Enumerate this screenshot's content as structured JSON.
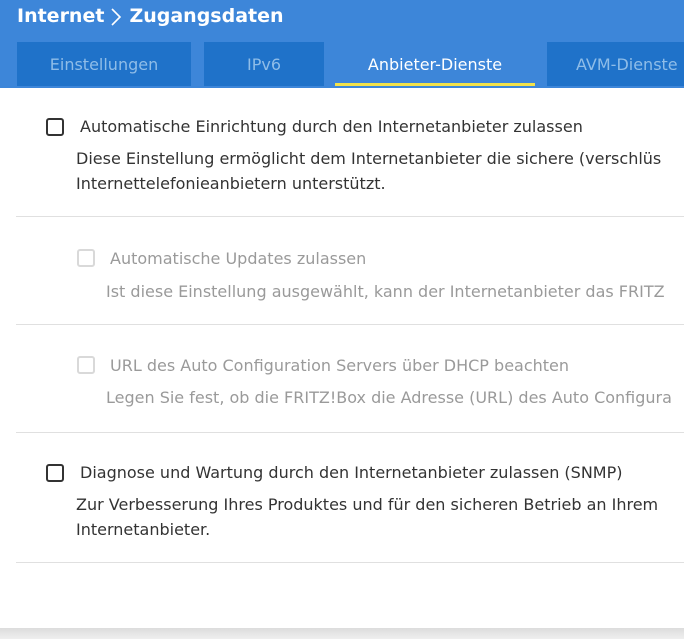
{
  "breadcrumb": {
    "parent": "Internet",
    "current": "Zugangsdaten",
    "separator_icon": "chevron-right-icon"
  },
  "tabs": [
    {
      "label": "Einstellungen",
      "active": false
    },
    {
      "label": "IPv6",
      "active": false
    },
    {
      "label": "Anbieter-Dienste",
      "active": true
    },
    {
      "label": "AVM-Dienste",
      "active": false
    }
  ],
  "colors": {
    "header_bg": "#3d86d9",
    "tab_bg": "#1f72c9",
    "active_tab_underline": "#f2e24a"
  },
  "options": [
    {
      "label": "Automatische Einrichtung durch den Internetanbieter zulassen",
      "checked": false,
      "disabled": false,
      "desc_line1": "Diese Einstellung ermöglicht dem Internetanbieter die sichere (verschlüs",
      "desc_line2": "Internettelefonieanbietern unterstützt."
    },
    {
      "label": "Automatische Updates zulassen",
      "checked": false,
      "disabled": true,
      "desc_line1": "Ist diese Einstellung ausgewählt, kann der Internetanbieter das FRITZ"
    },
    {
      "label": "URL des Auto Configuration Servers über DHCP beachten",
      "checked": false,
      "disabled": true,
      "desc_line1": "Legen Sie fest, ob die FRITZ!Box die Adresse (URL) des Auto Configura"
    },
    {
      "label": "Diagnose und Wartung durch den Internetanbieter zulassen (SNMP)",
      "checked": false,
      "disabled": false,
      "desc_line1": "Zur Verbesserung Ihres Produktes und für den sicheren Betrieb an Ihrem",
      "desc_line2": "Internetanbieter."
    }
  ]
}
